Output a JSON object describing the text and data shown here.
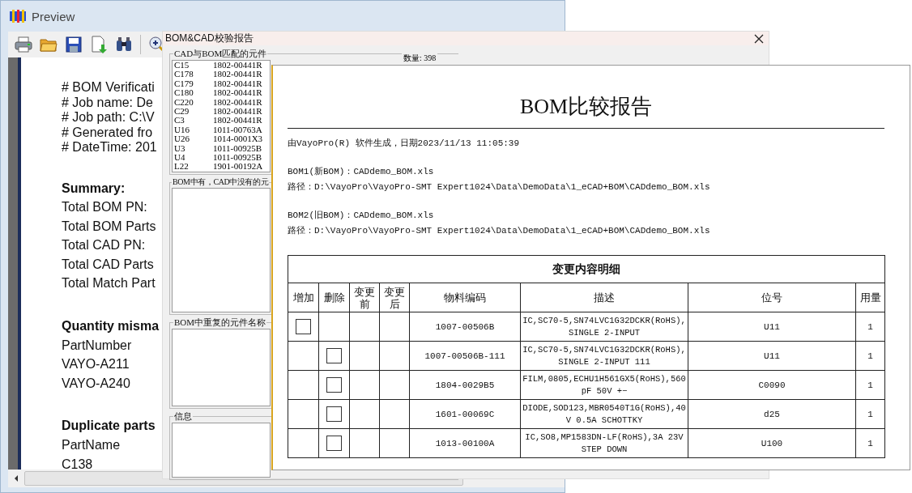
{
  "preview": {
    "title": "Preview",
    "lines": [
      {
        "kind": "comment",
        "text": "# BOM Verificati"
      },
      {
        "kind": "comment",
        "text": "# Job name: De"
      },
      {
        "kind": "comment",
        "text": "# Job path: C:\\V"
      },
      {
        "kind": "comment",
        "text": "# Generated fro"
      },
      {
        "kind": "comment",
        "text": "# DateTime: 201"
      },
      {
        "kind": "heading",
        "text": "Summary:"
      },
      {
        "kind": "line",
        "text": "Total BOM PN:"
      },
      {
        "kind": "line",
        "text": "Total BOM Parts"
      },
      {
        "kind": "line",
        "text": "Total CAD PN:"
      },
      {
        "kind": "line",
        "text": "Total CAD Parts"
      },
      {
        "kind": "line",
        "text": "Total Match Part"
      },
      {
        "kind": "heading",
        "text": "Quantity misma"
      },
      {
        "kind": "line",
        "text": "PartNumber"
      },
      {
        "kind": "line",
        "text": "VAYO-A211"
      },
      {
        "kind": "line",
        "text": "VAYO-A240"
      },
      {
        "kind": "heading",
        "text": "Duplicate parts"
      },
      {
        "kind": "line",
        "text": "PartName"
      },
      {
        "kind": "line",
        "text": "C138"
      }
    ]
  },
  "dialog": {
    "title": "BOM&CAD校验报告",
    "groups": [
      {
        "title": "CAD与BOM匹配的元件",
        "count": "数量: 398",
        "items": [
          {
            "name": "C15",
            "code": "1802-00441R"
          },
          {
            "name": "C178",
            "code": "1802-00441R"
          },
          {
            "name": "C179",
            "code": "1802-00441R"
          },
          {
            "name": "C180",
            "code": "1802-00441R"
          },
          {
            "name": "C220",
            "code": "1802-00441R"
          },
          {
            "name": "C29",
            "code": "1802-00441R"
          },
          {
            "name": "C3",
            "code": "1802-00441R"
          },
          {
            "name": "U16",
            "code": "1011-00763A"
          },
          {
            "name": "U26",
            "code": "1014-0001X3"
          },
          {
            "name": "U3",
            "code": "1011-00925B"
          },
          {
            "name": "U4",
            "code": "1011-00925B"
          },
          {
            "name": "L22",
            "code": "1901-00192A"
          }
        ]
      },
      {
        "title": "BOM中有，CAD中没有的元"
      },
      {
        "title": "BOM中重复的元件名称"
      },
      {
        "title": "信息"
      }
    ]
  },
  "report": {
    "title": "BOM比较报告",
    "generated": "由VayoPro(R) 软件生成，日期2023/11/13 11:05:39",
    "boms": [
      {
        "label": "BOM1(新BOM)：CADdemo_BOM.xls",
        "path": "路径：D:\\VayoPro\\VayoPro-SMT Expert1024\\Data\\DemoData\\1_eCAD+BOM\\CADdemo_BOM.xls"
      },
      {
        "label": "BOM2(旧BOM)：CADdemo_BOM.xls",
        "path": "路径：D:\\VayoPro\\VayoPro-SMT Expert1024\\Data\\DemoData\\1_eCAD+BOM\\CADdemo_BOM.xls"
      }
    ],
    "table": {
      "caption": "变更内容明细",
      "columns": [
        "增加",
        "删除",
        "变更前",
        "变更后",
        "物料编码",
        "描述",
        "位号",
        "用量"
      ],
      "rows": [
        {
          "marks": [
            {
              "kind": "checkbox",
              "checked": false
            },
            {
              "kind": "empty"
            },
            {
              "kind": "empty"
            },
            {
              "kind": "empty"
            }
          ],
          "code": "1007-00506B",
          "description": "IC,SC70-5,SN74LVC1G32DCKR(RoHS),SINGLE 2-INPUT",
          "ref": "U11",
          "qty": "1"
        },
        {
          "marks": [
            {
              "kind": "empty"
            },
            {
              "kind": "checkbox",
              "checked": false
            },
            {
              "kind": "empty"
            },
            {
              "kind": "empty"
            }
          ],
          "code": "1007-00506B-111",
          "description": "IC,SC70-5,SN74LVC1G32DCKR(RoHS),SINGLE 2-INPUT 111",
          "ref": "U11",
          "qty": "1"
        },
        {
          "marks": [
            {
              "kind": "empty"
            },
            {
              "kind": "checkbox",
              "checked": false
            },
            {
              "kind": "empty"
            },
            {
              "kind": "empty"
            }
          ],
          "code": "1804-0029B5",
          "description": "FILM,0805,ECHU1H561GX5(RoHS),560pF 50V +−",
          "ref": "C0090",
          "qty": "1"
        },
        {
          "marks": [
            {
              "kind": "empty"
            },
            {
              "kind": "checkbox",
              "checked": false
            },
            {
              "kind": "empty"
            },
            {
              "kind": "empty"
            }
          ],
          "code": "1601-00069C",
          "description": "DIODE,SOD123,MBR0540T1G(RoHS),40V 0.5A SCHOTTKY",
          "ref": "d25",
          "qty": "1"
        },
        {
          "marks": [
            {
              "kind": "empty"
            },
            {
              "kind": "checkbox",
              "checked": false
            },
            {
              "kind": "empty"
            },
            {
              "kind": "empty"
            }
          ],
          "code": "1013-00100A",
          "description": "IC,SO8,MP1583DN-LF(RoHS),3A 23V STEP DOWN",
          "ref": "U100",
          "qty": "1"
        }
      ]
    }
  }
}
